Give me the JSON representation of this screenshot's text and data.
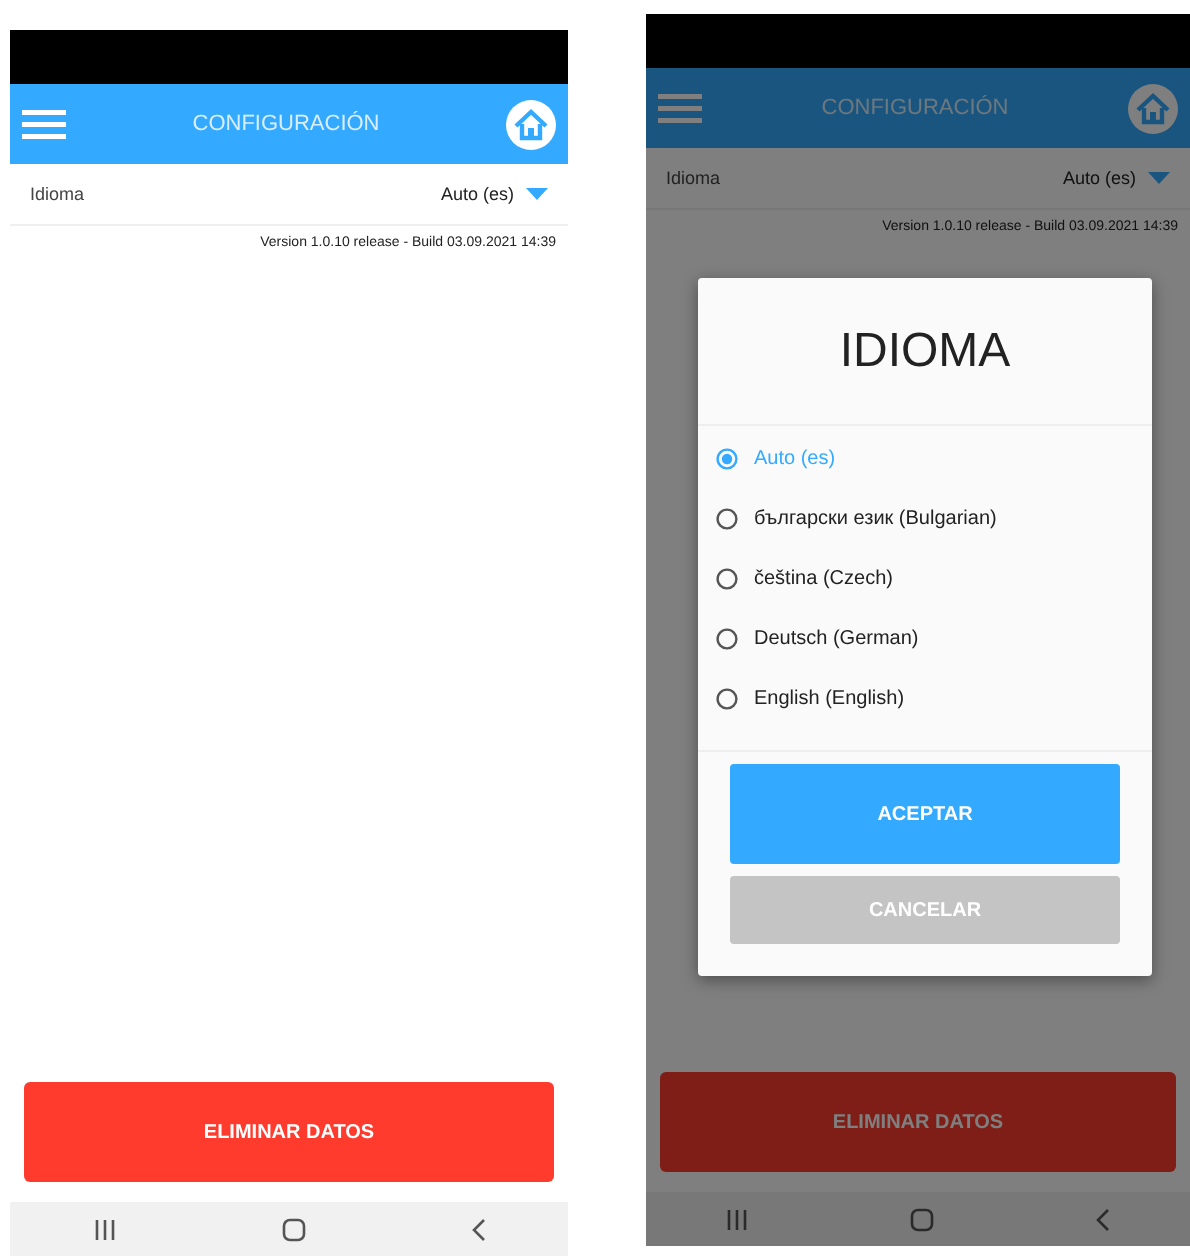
{
  "screens": [
    {
      "title": "CONFIGURACIÓN",
      "setting": {
        "label": "Idioma",
        "value": "Auto (es)"
      },
      "version": "Version 1.0.10 release - Build 03.09.2021 14:39",
      "delete_button": "ELIMINAR DATOS"
    },
    {
      "title": "CONFIGURACIÓN",
      "setting": {
        "label": "Idioma",
        "value": "Auto (es)"
      },
      "version": "Version 1.0.10 release - Build 03.09.2021 14:39",
      "delete_button": "ELIMINAR DATOS",
      "dialog": {
        "title": "IDIOMA",
        "options": [
          {
            "label": "Auto (es)",
            "selected": true
          },
          {
            "label": "български език (Bulgarian)",
            "selected": false
          },
          {
            "label": "čeština (Czech)",
            "selected": false
          },
          {
            "label": "Deutsch (German)",
            "selected": false
          },
          {
            "label": "English (English)",
            "selected": false
          }
        ],
        "buttons": [
          {
            "label": "ACEPTAR",
            "kind": "primary"
          },
          {
            "label": "CANCELAR",
            "kind": "secondary"
          }
        ]
      }
    }
  ]
}
